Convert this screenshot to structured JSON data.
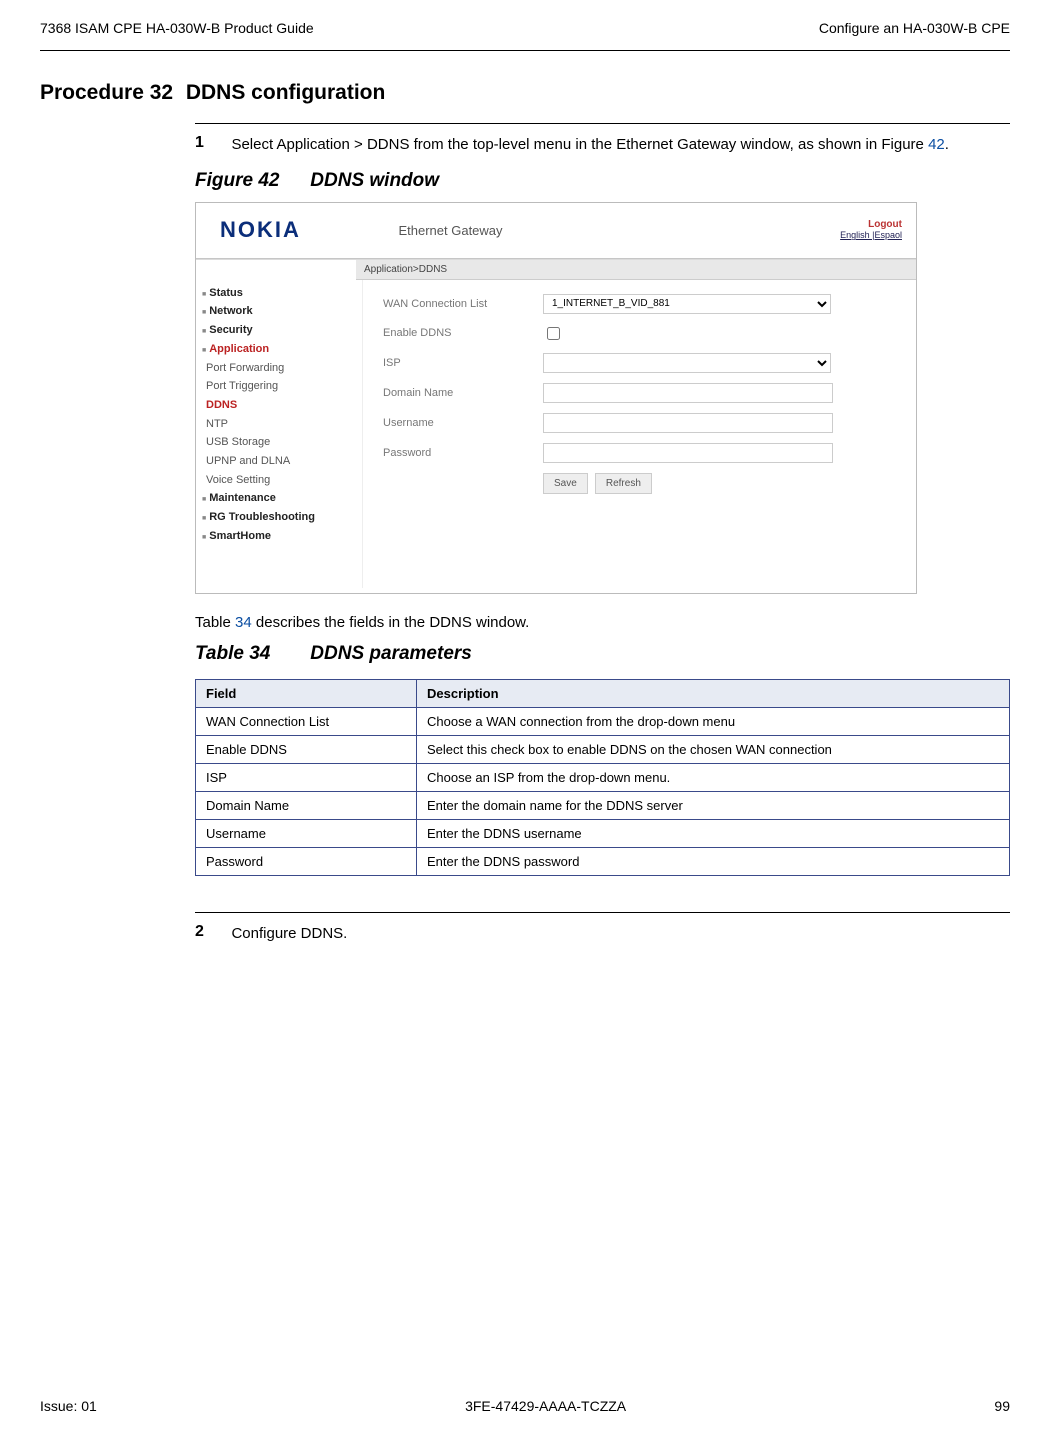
{
  "header": {
    "left": "7368 ISAM CPE HA-030W-B Product Guide",
    "right": "Configure an HA-030W-B CPE"
  },
  "procedure": {
    "label": "Procedure 32",
    "title": "DDNS configuration"
  },
  "step1": {
    "num": "1",
    "text_a": "Select Application > DDNS from the top-level menu in the Ethernet Gateway window, as shown in Figure ",
    "figref": "42",
    "text_b": "."
  },
  "figure": {
    "label": "Figure 42",
    "title": "DDNS window"
  },
  "screenshot": {
    "logo": "NOKIA",
    "gateway_title": "Ethernet Gateway",
    "logout": "Logout",
    "lang": "English |Espaol",
    "crumb": "Application>DDNS",
    "nav": {
      "status": "Status",
      "network": "Network",
      "security": "Security",
      "application": "Application",
      "port_forwarding": "Port Forwarding",
      "port_triggering": "Port Triggering",
      "ddns": "DDNS",
      "ntp": "NTP",
      "usb": "USB Storage",
      "upnp": "UPNP and DLNA",
      "voice": "Voice Setting",
      "maintenance": "Maintenance",
      "rg": "RG Troubleshooting",
      "smarthome": "SmartHome"
    },
    "form": {
      "wan_label": "WAN Connection List",
      "wan_value": "1_INTERNET_B_VID_881",
      "enable_label": "Enable DDNS",
      "isp_label": "ISP",
      "domain_label": "Domain Name",
      "user_label": "Username",
      "pass_label": "Password",
      "save": "Save",
      "refresh": "Refresh"
    }
  },
  "table_intro_a": "Table ",
  "table_intro_ref": "34",
  "table_intro_b": " describes the fields in the DDNS window.",
  "table": {
    "label": "Table 34",
    "title": "DDNS parameters",
    "head_field": "Field",
    "head_desc": "Description",
    "rows": [
      {
        "f": "WAN Connection List",
        "d": "Choose a WAN connection from the drop-down menu"
      },
      {
        "f": "Enable DDNS",
        "d": "Select this check box to enable DDNS on the chosen WAN connection"
      },
      {
        "f": "ISP",
        "d": "Choose an ISP from the drop-down menu."
      },
      {
        "f": "Domain Name",
        "d": "Enter the domain name for the DDNS server"
      },
      {
        "f": "Username",
        "d": "Enter the DDNS username"
      },
      {
        "f": "Password",
        "d": "Enter the DDNS password"
      }
    ]
  },
  "step2": {
    "num": "2",
    "text": "Configure DDNS."
  },
  "footer": {
    "issue": "Issue: 01",
    "docnum": "3FE-47429-AAAA-TCZZA",
    "page": "99"
  }
}
